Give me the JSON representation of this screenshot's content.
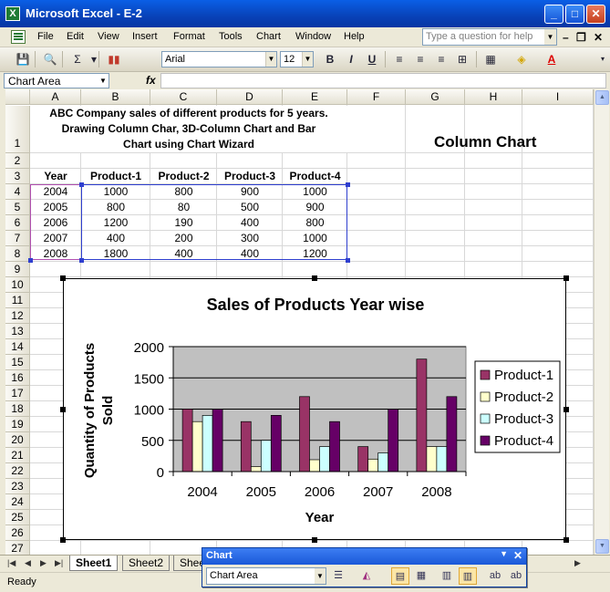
{
  "window": {
    "title": "Microsoft Excel - E-2"
  },
  "menu": [
    "File",
    "Edit",
    "View",
    "Insert",
    "Format",
    "Tools",
    "Chart",
    "Window",
    "Help"
  ],
  "ask_placeholder": "Type a question for help",
  "toolbar": {
    "font": "Arial",
    "size": "12",
    "bold": "B",
    "italic": "I",
    "underline": "U"
  },
  "formula_bar": {
    "name_box": "Chart Area",
    "fx": "fx"
  },
  "columns": [
    "A",
    "B",
    "C",
    "D",
    "E",
    "F",
    "G",
    "H",
    "I"
  ],
  "rows": [
    "1",
    "2",
    "3",
    "4",
    "5",
    "6",
    "7",
    "8",
    "9",
    "10",
    "11",
    "12",
    "13",
    "14",
    "15",
    "16",
    "17",
    "18",
    "19",
    "20",
    "21",
    "22",
    "23",
    "24",
    "25",
    "26",
    "27"
  ],
  "sheet": {
    "title_lines": [
      "ABC Company sales of different products for 5 years.",
      "Drawing Column Char, 3D-Column Chart and Bar",
      "Chart using Chart Wizard"
    ],
    "column_chart_label": "Column Chart",
    "table_headers": [
      "Year",
      "Product-1",
      "Product-2",
      "Product-3",
      "Product-4"
    ],
    "table_rows": [
      [
        "2004",
        "1000",
        "800",
        "900",
        "1000"
      ],
      [
        "2005",
        "800",
        "80",
        "500",
        "900"
      ],
      [
        "2006",
        "1200",
        "190",
        "400",
        "800"
      ],
      [
        "2007",
        "400",
        "200",
        "300",
        "1000"
      ],
      [
        "2008",
        "1800",
        "400",
        "400",
        "1200"
      ]
    ]
  },
  "chart_data": {
    "type": "bar",
    "title": "Sales of Products Year wise",
    "xlabel": "Year",
    "ylabel": "Quantity of Products Sold",
    "ylabel_lines": [
      "Quantity of Products",
      "Sold"
    ],
    "categories": [
      "2004",
      "2005",
      "2006",
      "2007",
      "2008"
    ],
    "ylim": [
      0,
      2000
    ],
    "yticks": [
      "0",
      "500",
      "1000",
      "1500",
      "2000"
    ],
    "ytick_values": [
      0,
      500,
      1000,
      1500,
      2000
    ],
    "grid": true,
    "legend": "right",
    "series": [
      {
        "name": "Product-1",
        "values": [
          1000,
          800,
          1200,
          400,
          1800
        ],
        "color": "#993366"
      },
      {
        "name": "Product-2",
        "values": [
          800,
          80,
          190,
          200,
          400
        ],
        "color": "#ffffcc"
      },
      {
        "name": "Product-3",
        "values": [
          900,
          500,
          400,
          300,
          400
        ],
        "color": "#ccffff"
      },
      {
        "name": "Product-4",
        "values": [
          1000,
          900,
          800,
          1000,
          1200
        ],
        "color": "#660066"
      }
    ],
    "plot_bg": "#c0c0c0"
  },
  "tabs": [
    "Sheet1",
    "Sheet2",
    "Shee"
  ],
  "status": "Ready",
  "chart_toolbar": {
    "title": "Chart",
    "selection": "Chart Area"
  }
}
